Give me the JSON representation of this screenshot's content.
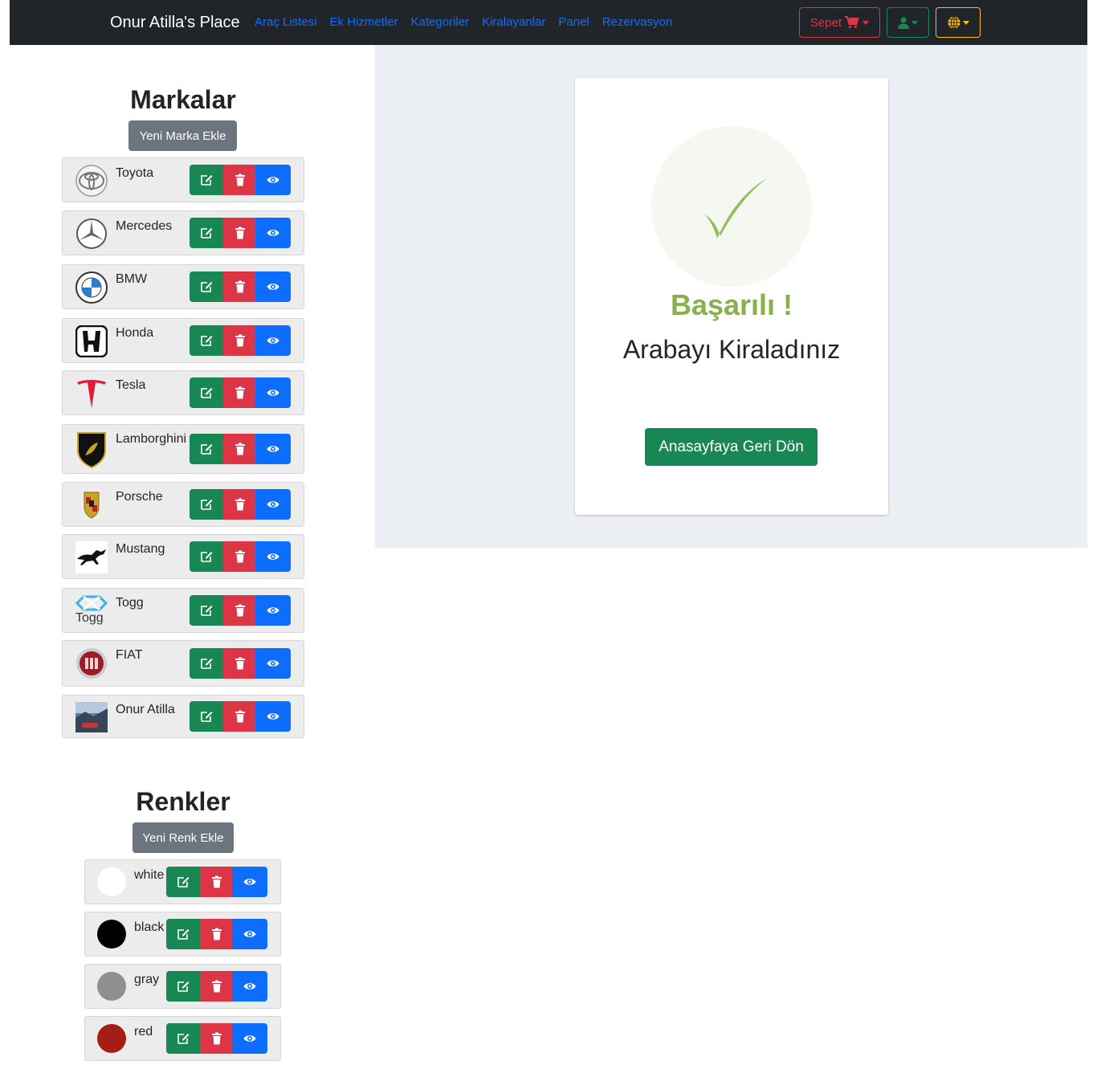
{
  "navbar": {
    "brand": "Onur Atilla's Place",
    "links": [
      "Araç Listesi",
      "Ek Hizmetler",
      "Kategoriler",
      "Kiralayanlar",
      "Panel",
      "Rezervasyon"
    ],
    "cart_label": "Sepet"
  },
  "brands": {
    "title": "Markalar",
    "add_label": "Yeni Marka Ekle",
    "items": [
      "Toyota",
      "Mercedes",
      "BMW",
      "Honda",
      "Tesla",
      "Lamborghini",
      "Porsche",
      "Mustang",
      "Togg",
      "FIAT",
      "Onur Atilla"
    ],
    "togg_logo_text": "Togg"
  },
  "colors": {
    "title": "Renkler",
    "add_label": "Yeni Renk Ekle",
    "items": [
      {
        "name": "white",
        "hex": "#ffffff"
      },
      {
        "name": "black",
        "hex": "#000000"
      },
      {
        "name": "gray",
        "hex": "#8f8f8f"
      },
      {
        "name": "red",
        "hex": "#a51d17"
      }
    ]
  },
  "result": {
    "title": "Başarılı !",
    "subtitle": "Arabayı Kiraladınız",
    "home_button": "Anasayfaya Geri Dön"
  },
  "theme": {
    "green": "#198754",
    "red": "#dc3545",
    "blue": "#0d6efd",
    "success_green": "#88b04b"
  }
}
